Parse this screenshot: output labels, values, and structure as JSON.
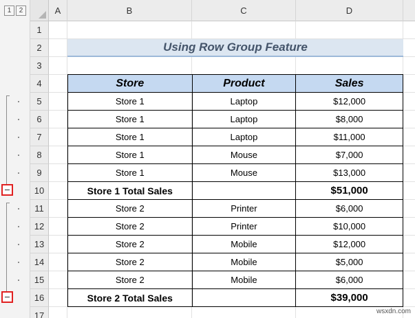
{
  "outline": {
    "level_buttons": [
      "1",
      "2"
    ]
  },
  "columns": [
    "A",
    "B",
    "C",
    "D"
  ],
  "rows": [
    "1",
    "2",
    "3",
    "4",
    "5",
    "6",
    "7",
    "8",
    "9",
    "10",
    "11",
    "12",
    "13",
    "14",
    "15",
    "16",
    "17"
  ],
  "title": "Using Row Group Feature",
  "table": {
    "headers": [
      "Store",
      "Product",
      "Sales"
    ],
    "rows": [
      [
        "Store 1",
        "Laptop",
        "$12,000"
      ],
      [
        "Store 1",
        "Laptop",
        "$8,000"
      ],
      [
        "Store 1",
        "Laptop",
        "$11,000"
      ],
      [
        "Store 1",
        "Mouse",
        "$7,000"
      ],
      [
        "Store 1",
        "Mouse",
        "$13,000"
      ],
      [
        "Store 1 Total Sales",
        "",
        "$51,000"
      ],
      [
        "Store 2",
        "Printer",
        "$6,000"
      ],
      [
        "Store 2",
        "Printer",
        "$10,000"
      ],
      [
        "Store 2",
        "Mobile",
        "$12,000"
      ],
      [
        "Store 2",
        "Mobile",
        "$5,000"
      ],
      [
        "Store 2",
        "Mobile",
        "$6,000"
      ],
      [
        "Store 2 Total Sales",
        "",
        "$39,000"
      ]
    ]
  },
  "watermark": "wsxdn.com",
  "colors": {
    "title_fill": "#dce6f1",
    "header_fill": "#c5d9f1",
    "highlight": "#e02020"
  },
  "icons": {
    "collapse": "minus-icon",
    "corner": "select-all-triangle-icon"
  }
}
